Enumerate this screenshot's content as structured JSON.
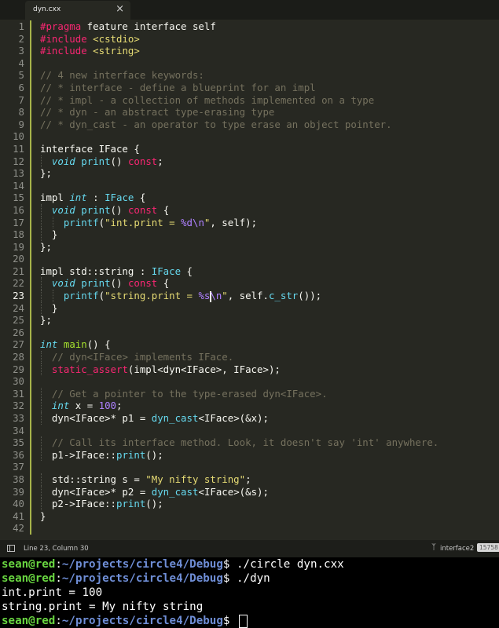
{
  "tab": {
    "title": "dyn.cxx",
    "close_icon": "close-icon"
  },
  "editor": {
    "current_line": 23,
    "modified_lines": [
      1,
      2,
      3,
      4,
      5,
      6,
      7,
      8,
      9,
      10,
      11,
      12,
      13,
      14,
      15,
      16,
      17,
      18,
      19,
      20,
      21,
      22,
      23,
      24,
      25,
      26,
      27,
      28,
      29,
      30,
      31,
      32,
      33,
      34,
      35,
      36,
      37,
      38,
      39,
      40,
      41,
      42
    ],
    "colors": {
      "background": "#272822",
      "foreground": "#f8f8f2",
      "keyword": "#f92672",
      "type": "#66d9ef",
      "string": "#e6db74",
      "number": "#ae81ff",
      "comment": "#75715e",
      "function": "#a6e22e",
      "gutter": "#8f908a"
    },
    "lines": [
      [
        [
          "#pragma",
          "k"
        ],
        [
          " feature interface self",
          ""
        ]
      ],
      [
        [
          "#include",
          "k"
        ],
        [
          " ",
          ""
        ],
        [
          "<cstdio>",
          "s"
        ]
      ],
      [
        [
          "#include",
          "k"
        ],
        [
          " ",
          ""
        ],
        [
          "<string>",
          "s"
        ]
      ],
      [],
      [
        [
          "// 4 new interface keywords:",
          "c"
        ]
      ],
      [
        [
          "// * interface - define a blueprint for an impl",
          "c"
        ]
      ],
      [
        [
          "// * impl - a collection of methods implemented on a type",
          "c"
        ]
      ],
      [
        [
          "// * dyn - an abstract type-erasing type",
          "c"
        ]
      ],
      [
        [
          "// * dyn_cast - an operator to type erase an object pointer.",
          "c"
        ]
      ],
      [],
      [
        [
          "interface IFace {",
          ""
        ]
      ],
      [
        [
          "  ",
          ""
        ],
        [
          "void",
          "ti"
        ],
        [
          " ",
          ""
        ],
        [
          "print",
          "t"
        ],
        [
          "() ",
          ""
        ],
        [
          "const",
          "k"
        ],
        [
          ";",
          ""
        ]
      ],
      [
        [
          "};",
          ""
        ]
      ],
      [],
      [
        [
          "impl ",
          ""
        ],
        [
          "int",
          "ti"
        ],
        [
          " : ",
          ""
        ],
        [
          "IFace",
          "t"
        ],
        [
          " {",
          ""
        ]
      ],
      [
        [
          "  ",
          ""
        ],
        [
          "void",
          "ti"
        ],
        [
          " ",
          ""
        ],
        [
          "print",
          "t"
        ],
        [
          "() ",
          ""
        ],
        [
          "const",
          "k"
        ],
        [
          " {",
          ""
        ]
      ],
      [
        [
          "    ",
          ""
        ],
        [
          "printf",
          "t"
        ],
        [
          "(",
          ""
        ],
        [
          "\"int.print = ",
          "s"
        ],
        [
          "%d",
          "n"
        ],
        [
          "\\n",
          "n"
        ],
        [
          "\"",
          "s"
        ],
        [
          ", self);",
          ""
        ]
      ],
      [
        [
          "  }",
          ""
        ]
      ],
      [
        [
          "};",
          ""
        ]
      ],
      [],
      [
        [
          "impl std::string : ",
          ""
        ],
        [
          "IFace",
          "t"
        ],
        [
          " {",
          ""
        ]
      ],
      [
        [
          "  ",
          ""
        ],
        [
          "void",
          "ti"
        ],
        [
          " ",
          ""
        ],
        [
          "print",
          "t"
        ],
        [
          "() ",
          ""
        ],
        [
          "const",
          "k"
        ],
        [
          " {",
          ""
        ]
      ],
      [
        [
          "    ",
          ""
        ],
        [
          "printf",
          "t"
        ],
        [
          "(",
          ""
        ],
        [
          "\"string.print = ",
          "s"
        ],
        [
          "%s",
          "n"
        ],
        [
          "|",
          ""
        ],
        [
          "\\n",
          "n"
        ],
        [
          "\"",
          "s"
        ],
        [
          ", self.",
          ""
        ],
        [
          "c_str",
          "t"
        ],
        [
          "());",
          ""
        ]
      ],
      [
        [
          "  }",
          ""
        ]
      ],
      [
        [
          "};",
          ""
        ]
      ],
      [],
      [
        [
          "int",
          "ti"
        ],
        [
          " ",
          ""
        ],
        [
          "main",
          "f"
        ],
        [
          "() {",
          ""
        ]
      ],
      [
        [
          "  ",
          ""
        ],
        [
          "// dyn<IFace> implements IFace.",
          "c"
        ]
      ],
      [
        [
          "  ",
          ""
        ],
        [
          "static_assert",
          "k"
        ],
        [
          "(impl<dyn<IFace>, IFace>);",
          ""
        ]
      ],
      [],
      [
        [
          "  ",
          ""
        ],
        [
          "// Get a pointer to the type-erased dyn<IFace>.",
          "c"
        ]
      ],
      [
        [
          "  ",
          ""
        ],
        [
          "int",
          "ti"
        ],
        [
          " x = ",
          ""
        ],
        [
          "100",
          "n"
        ],
        [
          ";",
          ""
        ]
      ],
      [
        [
          "  dyn<IFace>* p1 = ",
          ""
        ],
        [
          "dyn_cast",
          "t"
        ],
        [
          "<IFace>(&x);",
          ""
        ]
      ],
      [],
      [
        [
          "  ",
          ""
        ],
        [
          "// Call its interface method. Look, it doesn't say 'int' anywhere.",
          "c"
        ]
      ],
      [
        [
          "  p1->IFace::",
          ""
        ],
        [
          "print",
          "t"
        ],
        [
          "();",
          ""
        ]
      ],
      [],
      [
        [
          "  std::string s = ",
          ""
        ],
        [
          "\"My nifty string\"",
          "s"
        ],
        [
          ";",
          ""
        ]
      ],
      [
        [
          "  dyn<IFace>* p2 = ",
          ""
        ],
        [
          "dyn_cast",
          "t"
        ],
        [
          "<IFace>(&s);",
          ""
        ]
      ],
      [
        [
          "  p2->IFace::",
          ""
        ],
        [
          "print",
          "t"
        ],
        [
          "();",
          ""
        ]
      ],
      [
        [
          "}",
          ""
        ]
      ],
      []
    ]
  },
  "statusbar": {
    "panel_icon": "panel-toggle-icon",
    "position": "Line 23, Column 30",
    "branch_icon": "git-branch-icon",
    "branch": "interface2",
    "count": "15758"
  },
  "terminal": {
    "lines": [
      {
        "prompt_user": "sean@red",
        "prompt_sep": ":",
        "prompt_path": "~/projects/circle4/Debug",
        "prompt_end": "$ ",
        "text": "./circle dyn.cxx"
      },
      {
        "prompt_user": "sean@red",
        "prompt_sep": ":",
        "prompt_path": "~/projects/circle4/Debug",
        "prompt_end": "$ ",
        "text": "./dyn"
      },
      {
        "text": "int.print = 100"
      },
      {
        "text": "string.print = My nifty string"
      },
      {
        "prompt_user": "sean@red",
        "prompt_sep": ":",
        "prompt_path": "~/projects/circle4/Debug",
        "prompt_end": "$ ",
        "text": "",
        "cursor": true
      }
    ]
  }
}
